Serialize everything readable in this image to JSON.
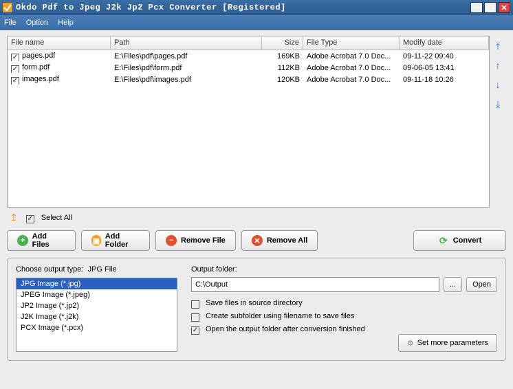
{
  "title": "Okdo Pdf to Jpeg J2k Jp2 Pcx Converter [Registered]",
  "menu": {
    "file": "File",
    "option": "Option",
    "help": "Help"
  },
  "cols": {
    "name": "File name",
    "path": "Path",
    "size": "Size",
    "type": "File Type",
    "date": "Modify date"
  },
  "rows": [
    {
      "name": "pages.pdf",
      "path": "E:\\Files\\pdf\\pages.pdf",
      "size": "169KB",
      "type": "Adobe Acrobat 7.0 Doc...",
      "date": "09-11-22 09:40"
    },
    {
      "name": "form.pdf",
      "path": "E:\\Files\\pdf\\form.pdf",
      "size": "112KB",
      "type": "Adobe Acrobat 7.0 Doc...",
      "date": "09-06-05 13:41"
    },
    {
      "name": "images.pdf",
      "path": "E:\\Files\\pdf\\images.pdf",
      "size": "120KB",
      "type": "Adobe Acrobat 7.0 Doc...",
      "date": "09-11-18 10:26"
    }
  ],
  "selectall": "Select All",
  "buttons": {
    "addfiles": "Add Files",
    "addfolder": "Add Folder",
    "removefile": "Remove File",
    "removeall": "Remove All",
    "convert": "Convert"
  },
  "outtype_label": "Choose output type:",
  "outtype_current": "JPG File",
  "outtypes": [
    "JPG Image (*.jpg)",
    "JPEG Image (*.jpeg)",
    "JP2 Image (*.jp2)",
    "J2K Image (*.j2k)",
    "PCX Image (*.pcx)"
  ],
  "outfolder_label": "Output folder:",
  "outfolder_value": "C:\\Output",
  "browse": "...",
  "open": "Open",
  "opts": {
    "savesrc": "Save files in source directory",
    "subfolder": "Create subfolder using filename to save files",
    "openafter": "Open the output folder after conversion finished"
  },
  "setmore": "Set more parameters"
}
